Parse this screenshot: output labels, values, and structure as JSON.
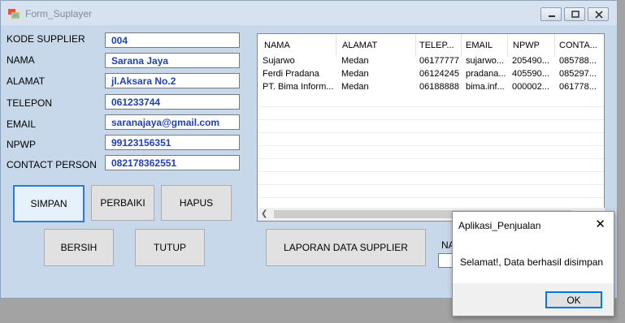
{
  "window": {
    "title": "Form_Suplayer"
  },
  "form": {
    "fields": [
      {
        "label": "KODE SUPPLIER",
        "value": "004"
      },
      {
        "label": "NAMA",
        "value": "Sarana Jaya"
      },
      {
        "label": "ALAMAT",
        "value": "jl.Aksara No.2"
      },
      {
        "label": "TELEPON",
        "value": "061233744"
      },
      {
        "label": "EMAIL",
        "value": "saranajaya@gmail.com"
      },
      {
        "label": "NPWP",
        "value": "99123156351"
      },
      {
        "label": "CONTACT PERSON",
        "value": "082178362551"
      }
    ]
  },
  "buttons": {
    "simpan": "SIMPAN",
    "perbaiki": "PERBAIKI",
    "hapus": "HAPUS",
    "bersih": "BERSIH",
    "tutup": "TUTUP",
    "laporan": "LAPORAN DATA SUPPLIER"
  },
  "grid": {
    "columns": [
      "NAMA",
      "ALAMAT",
      "TELEP...",
      "EMAIL",
      "NPWP",
      "CONTA..."
    ],
    "rows": [
      [
        "Sujarwo",
        "Medan",
        "06177777",
        "sujarwo...",
        "205490...",
        "085788..."
      ],
      [
        "Ferdi Pradana",
        "Medan",
        "06124245",
        "pradana...",
        "405590...",
        "085297..."
      ],
      [
        "PT. Bima Inform...",
        "Medan",
        "06188888",
        "bima.inf...",
        "000002...",
        "061778..."
      ]
    ]
  },
  "partial_label": "NA",
  "dialog": {
    "title": "Aplikasi_Penjualan",
    "message": "Selamat!, Data berhasil disimpan",
    "ok_label": "OK"
  }
}
